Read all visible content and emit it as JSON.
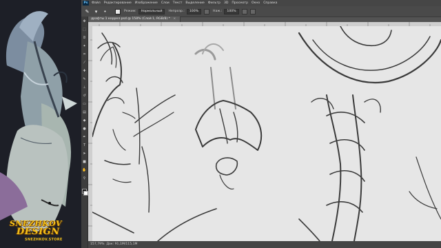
{
  "menu": {
    "items": [
      "Файл",
      "Редактирование",
      "Изображение",
      "Слои",
      "Текст",
      "Выделение",
      "Фильтр",
      "3D",
      "Просмотр",
      "Окно",
      "Справка"
    ]
  },
  "options": {
    "mode_label": "Режим:",
    "mode_value": "Нормальный",
    "opacity_label": "Непрозр.:",
    "opacity_value": "100%",
    "pressure_label": "Наж.:",
    "pressure_value": "100%"
  },
  "document": {
    "tab_title": "драфты 1 коррел.psd @ 158% (Слой 1, RGB/8) *",
    "close_glyph": "×"
  },
  "status": {
    "zoom": "157,79%",
    "doc_info": "Док: 91,1M/115,1M"
  },
  "overlay": {
    "logo_line1": "SNEZHKOV",
    "logo_line2": "DESIGN",
    "logo_url": "SNEZHKOV.STORE"
  },
  "colors": {
    "ui_dark": "#535353",
    "canvas": "#e6e6e6",
    "logo_gold": "#f4c21c",
    "painting_bg": "#1d1f27"
  },
  "icons": [
    "move-icon",
    "marquee-icon",
    "lasso-icon",
    "quick-select-icon",
    "crop-icon",
    "eyedropper-icon",
    "healing-icon",
    "brush-icon",
    "stamp-icon",
    "history-brush-icon",
    "eraser-icon",
    "gradient-icon",
    "blur-icon",
    "dodge-icon",
    "pen-icon",
    "type-icon",
    "path-select-icon",
    "shape-icon",
    "hand-icon",
    "zoom-icon"
  ]
}
